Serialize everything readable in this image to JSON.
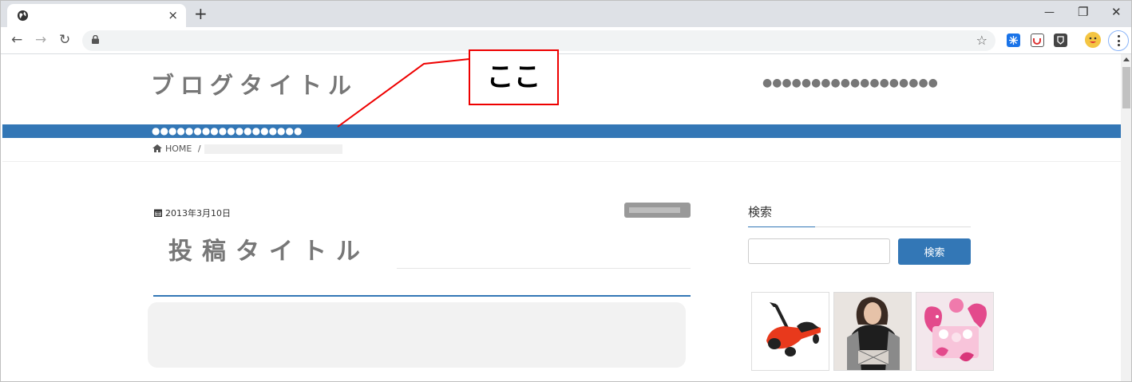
{
  "browser": {
    "tab_close": "×",
    "new_tab": "+",
    "win_minimize": "—",
    "win_restore": "❐",
    "win_close": "✕",
    "back": "←",
    "forward": "→",
    "reload": "↻",
    "bookmark_star": "☆"
  },
  "site": {
    "title": "ブログタイトル",
    "header_right": "●●●●●●●●●●●●●●●●●●",
    "nav_text": "●●●●●●●●●●●●●●●●●●",
    "breadcrumb_home": "HOME",
    "breadcrumb_sep": "/"
  },
  "post": {
    "date": "2013年3月10日",
    "title": "投稿タイトル"
  },
  "sidebar": {
    "search_title": "検索",
    "search_value": "",
    "search_button": "検索"
  },
  "annotation": {
    "label": "ここ",
    "color": "#e00000"
  },
  "colors": {
    "accent": "#3377b6"
  }
}
